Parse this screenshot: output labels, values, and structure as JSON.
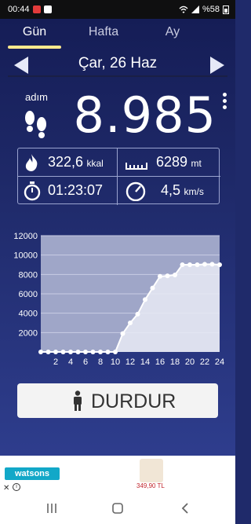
{
  "status": {
    "time": "00:44",
    "battery": "%58"
  },
  "tabs": [
    {
      "label": "Gün"
    },
    {
      "label": "Hafta"
    },
    {
      "label": "Ay"
    }
  ],
  "date": "Çar, 26 Haz",
  "steps": {
    "label": "adım",
    "value": "8.985"
  },
  "stats": {
    "calories": {
      "value": "322,6",
      "unit": "kkal"
    },
    "distance": {
      "value": "6289",
      "unit": "mt"
    },
    "duration": {
      "value": "01:23:07"
    },
    "speed": {
      "value": "4,5",
      "unit": "km/s"
    }
  },
  "chart_data": {
    "type": "line",
    "x": [
      0,
      1,
      2,
      3,
      4,
      5,
      6,
      7,
      8,
      9,
      10,
      11,
      12,
      13,
      14,
      15,
      16,
      17,
      18,
      19,
      20,
      21,
      22,
      23,
      24
    ],
    "values": [
      0,
      0,
      0,
      0,
      0,
      0,
      0,
      0,
      0,
      0,
      0,
      1900,
      3000,
      3900,
      5400,
      6600,
      7800,
      7850,
      7950,
      9000,
      9000,
      9000,
      9050,
      9050,
      9000
    ],
    "xticks": [
      "2",
      "4",
      "6",
      "8",
      "10",
      "12",
      "14",
      "16",
      "18",
      "20",
      "22",
      "24"
    ],
    "yticks": [
      "2000",
      "4000",
      "6000",
      "8000",
      "10000",
      "12000"
    ],
    "ylim": [
      0,
      12000
    ],
    "xlim": [
      0,
      24
    ],
    "grid": true
  },
  "button": {
    "label": "DURDUR"
  },
  "ad": {
    "brand": "watsons",
    "price": "349,90 TL"
  }
}
